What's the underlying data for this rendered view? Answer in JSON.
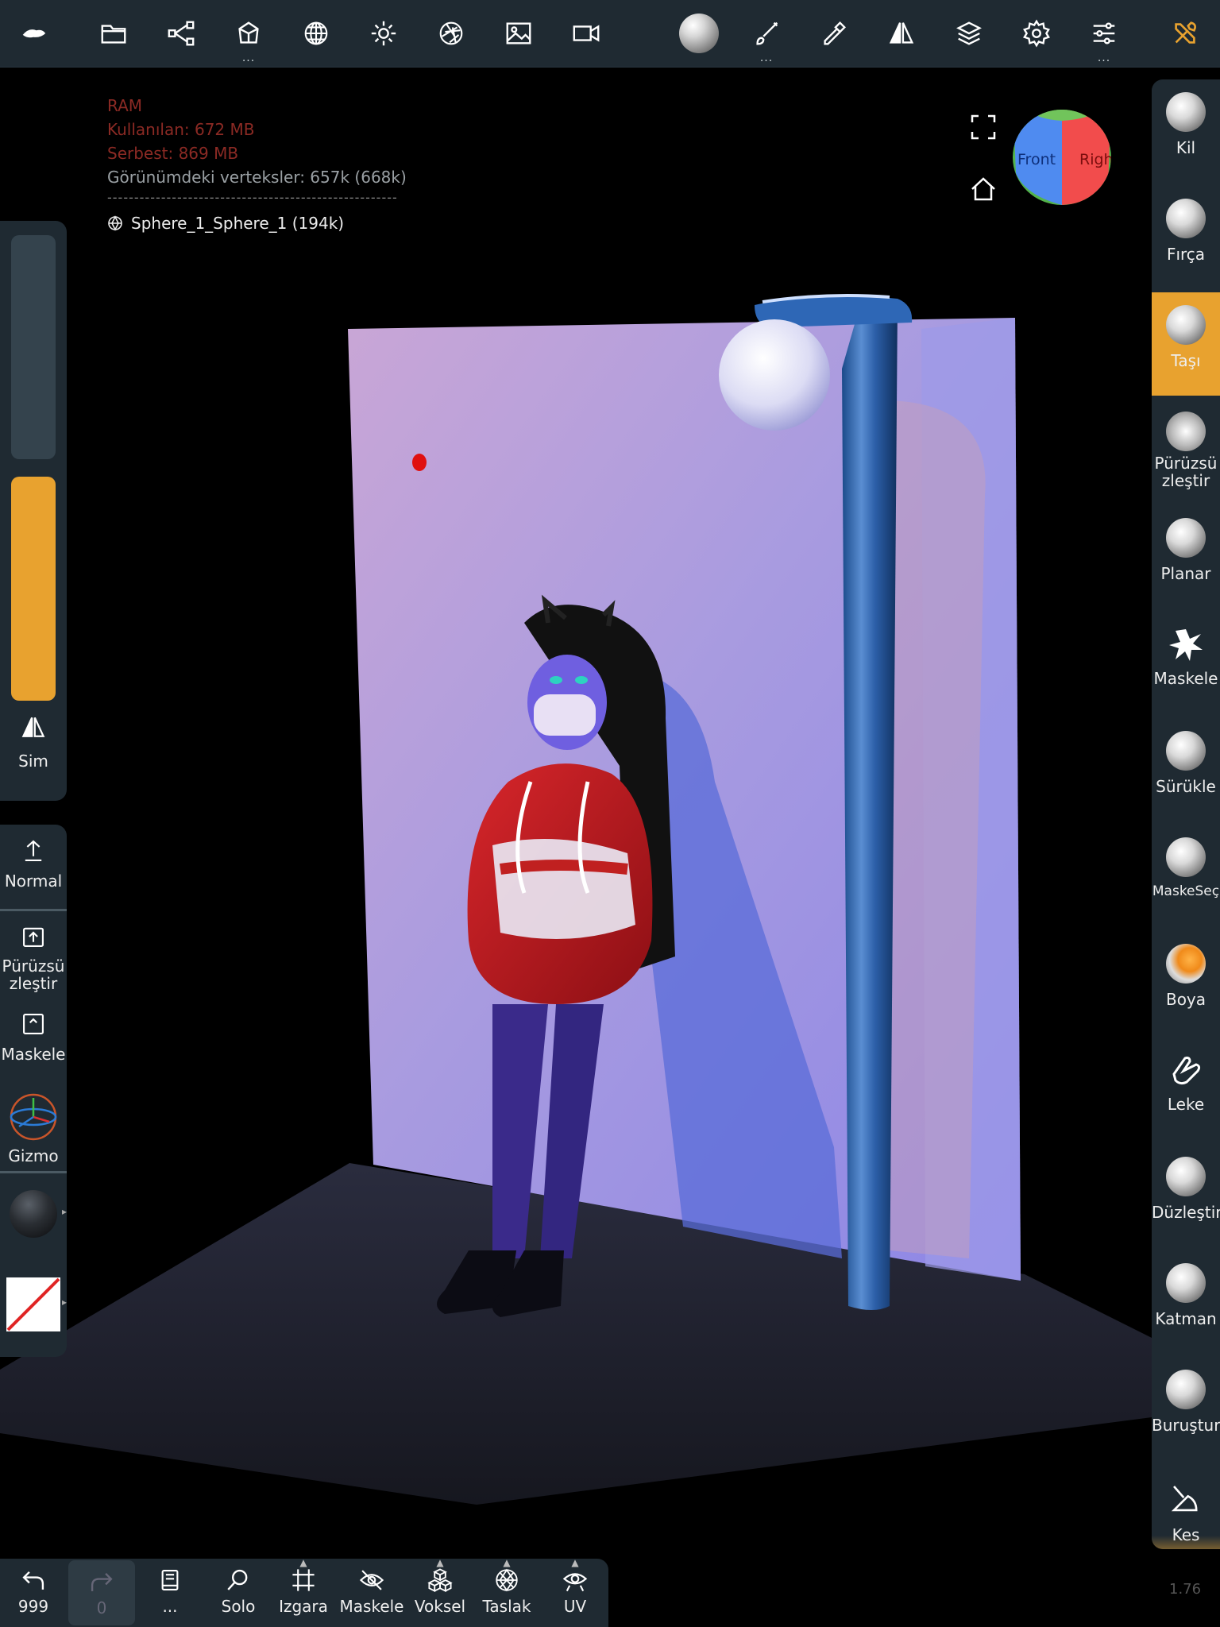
{
  "top_toolbar": {
    "icons": [
      "logo-icon",
      "folder-icon",
      "share-icon",
      "box-icon",
      "sphere-grid-icon",
      "sun-icon",
      "aperture-icon",
      "image-icon",
      "camera-icon",
      "material-sphere-icon",
      "brush-icon",
      "eyedropper-icon",
      "symmetry-icon",
      "layers-icon",
      "gear-icon",
      "sliders-icon",
      "tools-icon"
    ],
    "dots": "..."
  },
  "info": {
    "ram_title": "RAM",
    "used": "Kullanılan: 672 MB",
    "free": "Serbest: 869 MB",
    "vertices": "Görünümdeki verteksler: 657k (668k)",
    "separator": "------------------------------------------------------",
    "mesh_name": "Sphere_1_Sphere_1 (194k)"
  },
  "view_cube": {
    "front": "Front",
    "right": "Right"
  },
  "left_panel": {
    "sim_label": "Sim",
    "normal_label": "Normal",
    "smooth_label_1": "Pürüzsü",
    "smooth_label_2": "zleştir",
    "mask_label": "Maskele",
    "gizmo_label": "Gizmo",
    "slider_colors": {
      "radius": "#34434d",
      "intensity": "#e8a22f"
    }
  },
  "right_tools": [
    {
      "label": "Kil"
    },
    {
      "label": "Fırça"
    },
    {
      "label": "Taşı",
      "active": true
    },
    {
      "label": "Pürüzsü zleştir"
    },
    {
      "label": "Planar"
    },
    {
      "label": "Maskele"
    },
    {
      "label": "Sürükle"
    },
    {
      "label": "MaskeSeç"
    },
    {
      "label": "Boya"
    },
    {
      "label": "Leke"
    },
    {
      "label": "Düzleştir"
    },
    {
      "label": "Katman"
    },
    {
      "label": "Buruştur"
    },
    {
      "label": "Kes"
    }
  ],
  "tool_labels": {
    "t0": "Kil",
    "t1": "Fırça",
    "t2": "Taşı",
    "t3a": "Pürüzsü",
    "t3b": "zleştir",
    "t4": "Planar",
    "t5": "Maskele",
    "t6": "Sürükle",
    "t7": "MaskeSeç",
    "t8": "Boya",
    "t9": "Leke",
    "t10": "Düzleştir",
    "t11": "Katman",
    "t12": "Buruştur",
    "t13": "Kes"
  },
  "bottom_bar": {
    "undo_count": "999",
    "redo_count": "0",
    "more": "...",
    "solo": "Solo",
    "grid": "Izgara",
    "mask": "Maskele",
    "voxel": "Voksel",
    "wireframe": "Taslak",
    "uv": "UV"
  },
  "version": "1.76",
  "accent_color": "#e8a22f"
}
